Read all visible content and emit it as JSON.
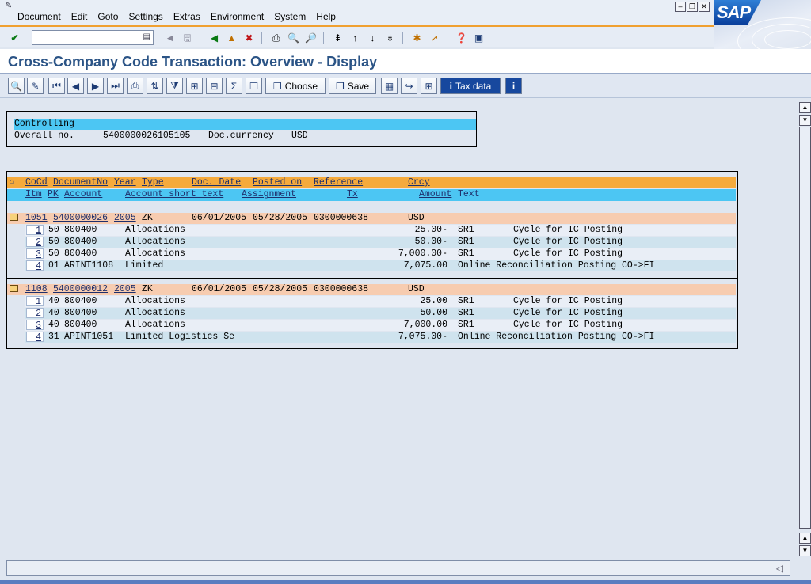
{
  "menu": {
    "items": [
      {
        "ul": "D",
        "rest": "ocument"
      },
      {
        "ul": "E",
        "rest": "dit"
      },
      {
        "ul": "G",
        "rest": "oto"
      },
      {
        "ul": "S",
        "rest": "ettings"
      },
      {
        "ul": "E",
        "rest": "xtras"
      },
      {
        "ul": "E",
        "rest": "nvironment"
      },
      {
        "ul": "S",
        "rest": "ystem"
      },
      {
        "ul": "H",
        "rest": "elp"
      }
    ]
  },
  "logo": {
    "text": "SAP"
  },
  "command_field": {
    "value": ""
  },
  "title": "Cross-Company Code Transaction: Overview - Display",
  "app_toolbar": {
    "choose_label": "Choose",
    "save_label": "Save",
    "tax_label": "Tax data"
  },
  "controlling": {
    "header": "Controlling",
    "overall_label": "Overall no.",
    "overall_value": "5400000026105105",
    "currency_label": "Doc.currency",
    "currency_value": "USD"
  },
  "table": {
    "header1": {
      "cocd": "CoCd",
      "docno": "DocumentNo",
      "year": "Year",
      "type": "Type",
      "docdate": "Doc. Date",
      "posted": "Posted on",
      "reference": "Reference",
      "crcy": "Crcy"
    },
    "header2": {
      "itm": "Itm",
      "pk": "PK",
      "account": "Account",
      "short": "Account short text",
      "assignment": "Assignment",
      "tx": "Tx",
      "amount": "Amount",
      "text": "Text"
    },
    "documents": [
      {
        "cocd": "1051",
        "docno": "5400000026",
        "year": "2005",
        "type": "ZK",
        "docdate": "06/01/2005",
        "posted": "05/28/2005",
        "reference": "0300000638",
        "crcy": "USD",
        "lines": [
          {
            "itm": "1",
            "pk": "50",
            "account": "800400",
            "short": "Allocations",
            "amount": "25.00-",
            "tx": "SR1",
            "text": "Cycle for IC Posting"
          },
          {
            "itm": "2",
            "pk": "50",
            "account": "800400",
            "short": "Allocations",
            "amount": "50.00-",
            "tx": "SR1",
            "text": "Cycle for IC Posting"
          },
          {
            "itm": "3",
            "pk": "50",
            "account": "800400",
            "short": "Allocations",
            "amount": "7,000.00-",
            "tx": "SR1",
            "text": "Cycle for IC Posting"
          },
          {
            "itm": "4",
            "pk": "01",
            "account": "ARINT1108",
            "short": "Limited",
            "amount": "7,075.00",
            "tx": "",
            "text": "Online Reconciliation Posting CO->FI"
          }
        ]
      },
      {
        "cocd": "1108",
        "docno": "5400000012",
        "year": "2005",
        "type": "ZK",
        "docdate": "06/01/2005",
        "posted": "05/28/2005",
        "reference": "0300000638",
        "crcy": "USD",
        "lines": [
          {
            "itm": "1",
            "pk": "40",
            "account": "800400",
            "short": "Allocations",
            "amount": "25.00",
            "tx": "SR1",
            "text": "Cycle for IC Posting"
          },
          {
            "itm": "2",
            "pk": "40",
            "account": "800400",
            "short": "Allocations",
            "amount": "50.00",
            "tx": "SR1",
            "text": "Cycle for IC Posting"
          },
          {
            "itm": "3",
            "pk": "40",
            "account": "800400",
            "short": "Allocations",
            "amount": "7,000.00",
            "tx": "SR1",
            "text": "Cycle for IC Posting"
          },
          {
            "itm": "4",
            "pk": "31",
            "account": "APINT1051",
            "short": "Limited Logistics Se",
            "amount": "7,075.00-",
            "tx": "",
            "text": "Online Reconciliation Posting CO->FI"
          }
        ]
      }
    ]
  },
  "status": {
    "text": ""
  }
}
